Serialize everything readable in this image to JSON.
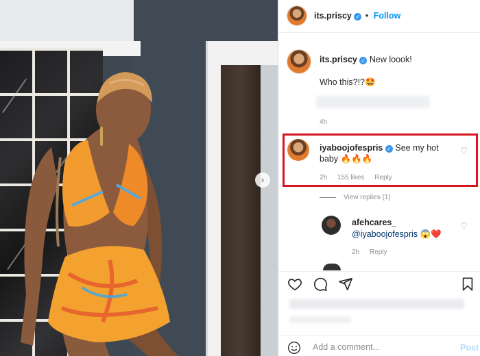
{
  "post": {
    "author": "its.priscy",
    "follow_label": "Follow",
    "separator": "•",
    "caption_username": "its.priscy",
    "caption_text": "New loook!",
    "caption_line2": "Who this?!?🤩",
    "timestamp": "4h"
  },
  "comments": [
    {
      "username": "iyaboojofespris",
      "text": "See my hot baby 🔥🔥🔥",
      "time": "2h",
      "likes": "155 likes",
      "reply_label": "Reply",
      "view_replies": "View replies (1)"
    },
    {
      "username": "afehcares_",
      "mention": "@iyaboojofespris",
      "text_suffix": " 😱❤️",
      "time": "2h",
      "reply_label": "Reply"
    }
  ],
  "comment_box": {
    "placeholder": "Add a comment...",
    "post_label": "Post"
  },
  "colors": {
    "highlight_border": "#d8141f",
    "follow_blue": "#0095f6",
    "verified_blue": "#3897f0"
  },
  "icons": [
    "verified-icon",
    "heart-icon",
    "comment-icon",
    "share-icon",
    "bookmark-icon",
    "emoji-icon",
    "next-arrow-icon"
  ]
}
